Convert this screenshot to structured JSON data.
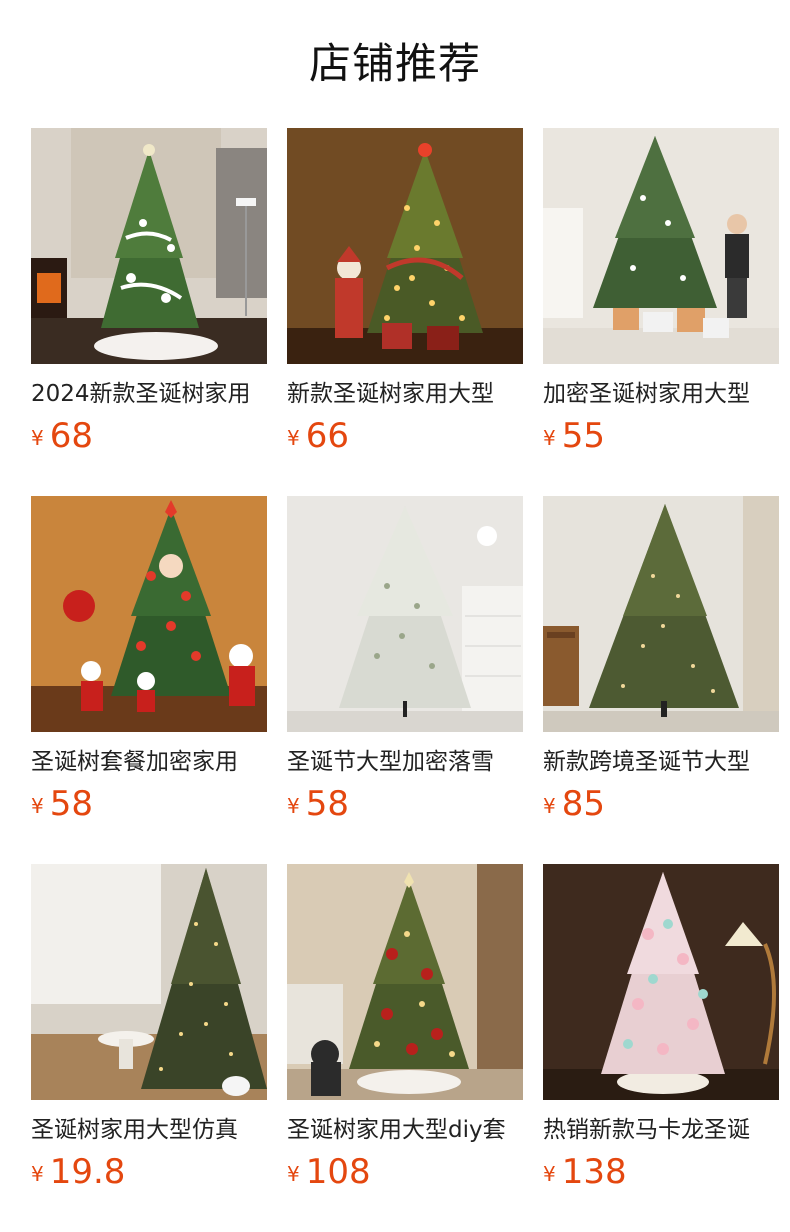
{
  "page": {
    "title": "店铺推荐"
  },
  "products": [
    {
      "name": "2024新款圣诞树家用",
      "currency": "¥",
      "price": "68",
      "image_icon": "christmas-tree-white-photo"
    },
    {
      "name": "新款圣诞树家用大型",
      "currency": "¥",
      "price": "66",
      "image_icon": "christmas-tree-gold-photo"
    },
    {
      "name": "加密圣诞树家用大型",
      "currency": "¥",
      "price": "55",
      "image_icon": "christmas-tree-green-photo"
    },
    {
      "name": "圣诞树套餐加密家用",
      "currency": "¥",
      "price": "58",
      "image_icon": "christmas-tree-set-photo"
    },
    {
      "name": "圣诞节大型加密落雪",
      "currency": "¥",
      "price": "58",
      "image_icon": "christmas-tree-snow-photo"
    },
    {
      "name": "新款跨境圣诞节大型",
      "currency": "¥",
      "price": "85",
      "image_icon": "christmas-tree-natural-photo"
    },
    {
      "name": "圣诞树家用大型仿真",
      "currency": "¥",
      "price": "19.8",
      "image_icon": "christmas-tree-lights-photo"
    },
    {
      "name": "圣诞树家用大型diy套",
      "currency": "¥",
      "price": "108",
      "image_icon": "christmas-tree-red-gold-photo"
    },
    {
      "name": "热销新款马卡龙圣诞",
      "currency": "¥",
      "price": "138",
      "image_icon": "christmas-tree-macaron-photo"
    }
  ],
  "colors": {
    "price": "#e4470f",
    "title": "#111111"
  }
}
